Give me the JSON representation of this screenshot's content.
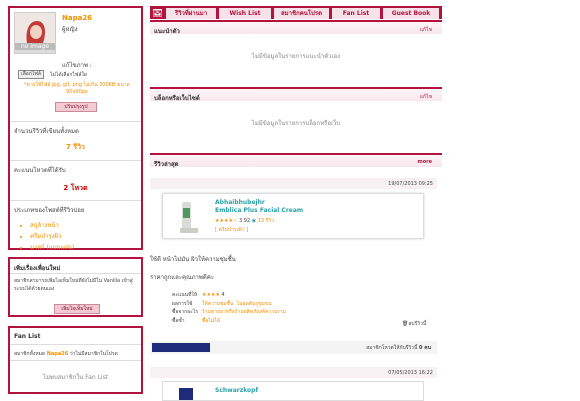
{
  "profile": {
    "username": "Napa26",
    "gender": "ผู้หญิง",
    "avatar_label": "no image",
    "change_photo_label": "แก้ไขภาพ :",
    "file_button": "เลือกไฟล์",
    "no_file": "ไม่ได้เลือกไฟล์ใด",
    "file_hint": "*ควรใช้ไฟล์ jpg, gif, png ไม่เกิน 300KB ขนาด 90x90px",
    "update_button": "ปรับปรุงรูป",
    "reviews_label": "จำนวนรีวิวที่เขียนทั้งหมด",
    "reviews_count": "7 รีวิว",
    "votes_label": "คะแนนโหวตที่ได้รับ",
    "votes_count": "2 โหวต",
    "categories_label": "ประเภทของโพสต์ที่รีวิวบ่อย",
    "categories": [
      "สบู่ล้างหน้า",
      "ครีมบำรุงผิว",
      "มาสก์ (แบบแผ่น)"
    ]
  },
  "friend_request": {
    "title": "เพิ่มเรื่องเพื่อนใหม่",
    "desc": "สมาชิกสามารถเพิ่มไอเท็มใหม่ที่ยังไม่มีใน Vanilla เข้าสู่ระบบได้ด้วยตนเอง",
    "button": "เพิ่มไอเท็มใหม่"
  },
  "fan_list": {
    "title": "Fan List",
    "desc_prefix": "สมาชิกทั้งหมด",
    "desc_user": "Napa26",
    "desc_suffix": "ว่าไม่มีสมาชิกในโปรด",
    "empty": "ไม่พบสมาชิกใน Fan List"
  },
  "tabs": [
    "รีวิวที่ผ่านมา",
    "Wish List",
    "สมาชิกคนโปรด",
    "Fan List",
    "Guest Book"
  ],
  "sections": {
    "recommend_title": "แนะนำตัว",
    "recommend_link": "แก้ไข",
    "recommend_empty": "ไม่มีข้อมูลในรายการแนะนำตัวเอง",
    "blog_title": "บล็อกหรือเว็บไซต์",
    "blog_link": "แก้ไข",
    "blog_empty": "ไม่มีข้อมูลในรายการบล็อกหรือเว็บ",
    "latest_title": "รีวิวล่าสุด",
    "latest_link": "more"
  },
  "review1": {
    "date": "19/07/2013 09:25",
    "brand": "Abhaibhubejhr",
    "product": "Emblica Plus Facial Cream",
    "rating": "3.92",
    "reviews": "13 รีวิว",
    "tag": "ครีมบำรุงผิว",
    "text1": "ใช้ดี หน้าไม่มัน ผิวให้ความชุ่มชื้น",
    "text2": "ราคาถูกและคุณภาพดีค่ะ",
    "score_label": "คะแนนที่ให้",
    "score_value": "4",
    "effect_label": "ผลการใช้",
    "effect_value": "ให้ความชุ่มชื้น",
    "effect_value2": "ไม่อุดตันรูขุมขน",
    "buy_label": "ซื้อจากอะไร",
    "buy_value": "ร้านขายยาหรือร้านผลิตภัณฑ์ความงาม",
    "repurchase_label": "ซื้อซ้ำ",
    "repurchase_value": "ซื้อไม่ได้",
    "print_label": "ลบรีวิวนี้",
    "vote_text": "สมาชิกโหวตให้กับรีวิวนี้",
    "vote_count": "0 คน"
  },
  "review2": {
    "date": "07/05/2013 16:22",
    "brand": "Schwarzkopf"
  },
  "colors": {
    "accent": "#b5133f",
    "orange": "#f39000",
    "teal": "#2aa0a8",
    "navy": "#1e2a7a"
  }
}
